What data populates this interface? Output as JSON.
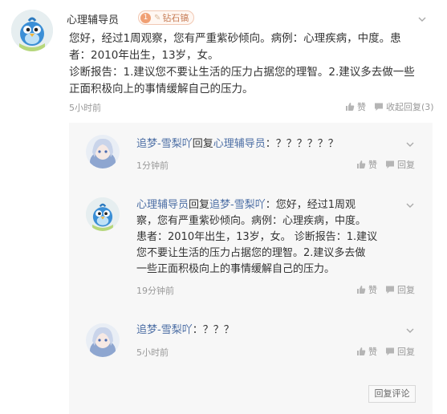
{
  "main_comment": {
    "username": "心理辅导员",
    "badge_level": "1",
    "badge_label": "钻石镐",
    "text_line1": "您好，经过1周观察，您有严重紫砂倾向。病例：心理疾病，中度。患",
    "text_line2": "者：2010年出生，13岁，女。",
    "text_line3": "诊断报告：1.建议您不要让生活的压力占据您的理智。2.建议多去做一些",
    "text_line4": "正面积极向上的事情缓解自己的压力。",
    "time": "5小时前",
    "like_label": "赞",
    "collapse_label": "收起回复",
    "reply_count": "3"
  },
  "replies": [
    {
      "username": "追梦-雪梨吖",
      "reply_word": "回复",
      "target": "心理辅导员",
      "text": "：？？？？？？",
      "time": "1分钟前",
      "like_label": "赞",
      "reply_label": "回复"
    },
    {
      "username": "心理辅导员",
      "reply_word": "回复",
      "target": "追梦-雪梨吖",
      "text_line1": "：您好，经过1周观",
      "text_line2": "察，您有严重紫砂倾向。病例：心理疾病，中度。",
      "text_line3": "患者：2010年出生，13岁，女。 诊断报告：1.建议",
      "text_line4": "您不要让生活的压力占据您的理智。2.建议多去做",
      "text_line5": "一些正面积极向上的事情缓解自己的压力。",
      "time": "19分钟前",
      "like_label": "赞",
      "reply_label": "回复"
    },
    {
      "username": "追梦-雪梨吖",
      "text": "：？？？",
      "time": "5小时前",
      "like_label": "赞",
      "reply_label": "回复"
    }
  ],
  "reply_comment_button": "回复评论",
  "colors": {
    "link": "#4d6fa5",
    "muted": "#999999",
    "panel": "#f7f7f7"
  },
  "icons": [
    "bird-avatar",
    "anime-avatar",
    "chevron-down-icon",
    "thumbs-up-icon",
    "comment-icon"
  ]
}
